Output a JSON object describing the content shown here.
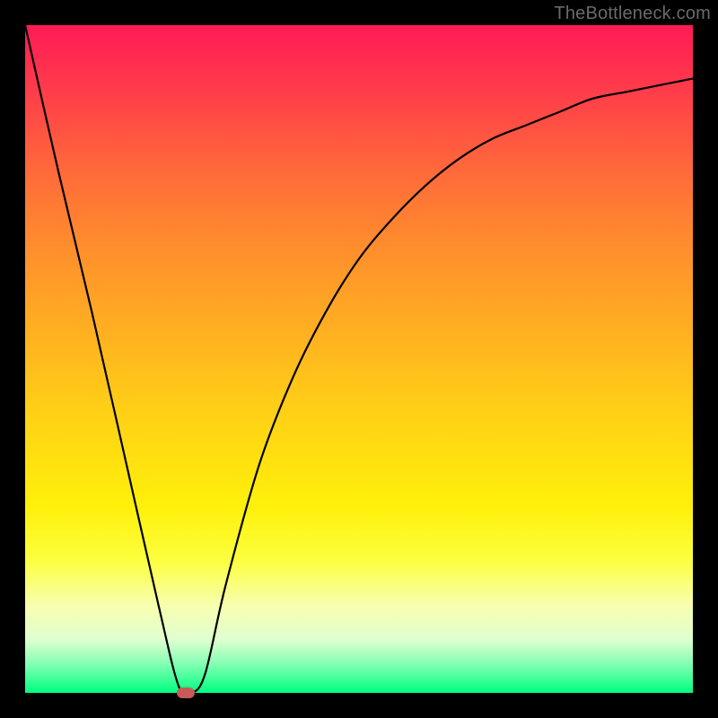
{
  "watermark": "TheBottleneck.com",
  "chart_data": {
    "type": "line",
    "title": "",
    "xlabel": "",
    "ylabel": "",
    "xlim": [
      0,
      100
    ],
    "ylim": [
      0,
      100
    ],
    "grid": false,
    "legend": false,
    "series": [
      {
        "name": "curve",
        "x": [
          0,
          5,
          10,
          15,
          20,
          23,
          25,
          27,
          30,
          35,
          40,
          45,
          50,
          55,
          60,
          65,
          70,
          75,
          80,
          85,
          90,
          95,
          100
        ],
        "y": [
          100,
          78,
          57,
          35,
          13,
          1,
          0,
          3,
          16,
          34,
          47,
          57,
          65,
          71,
          76,
          80,
          83,
          85,
          87,
          89,
          90,
          91,
          92
        ]
      }
    ],
    "marker": {
      "x": 24,
      "y": 0
    },
    "background_gradient": {
      "top": "#ff1a56",
      "bottom": "#00ff80"
    }
  }
}
